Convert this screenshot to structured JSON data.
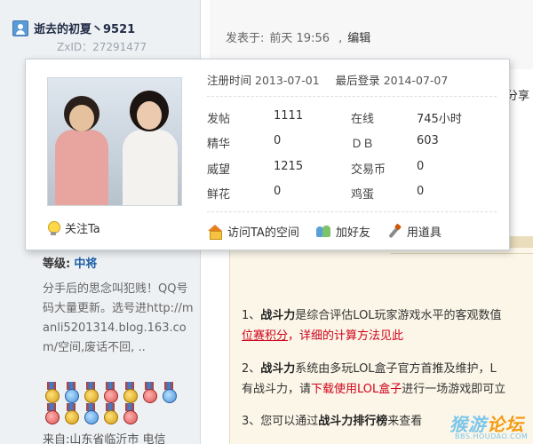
{
  "user": {
    "name": "逝去的初夏丶9521",
    "zxid": "ZxID：27291477",
    "level_label": "等级:",
    "level_value": "中将",
    "signature": "分手后的思念叫犯贱！QQ号码大量更新。选号进http://manli5201314.blog.163.com/空间,废话不回, ..",
    "from": "来自:山东省临沂市 电信",
    "medals": [
      "medal-1",
      "medal-2",
      "medal-3",
      "medal-4",
      "medal-5",
      "medal-6",
      "medal-7",
      "medal-8",
      "medal-9",
      "medal-10",
      "medal-11",
      "medal-12"
    ]
  },
  "post": {
    "meta_prefix": "发表于:",
    "meta_time": "前天 19:56",
    "meta_sep": ",",
    "edit_label": "编辑",
    "partial_share": "分享",
    "para1": {
      "num": "1、",
      "term": "战斗力",
      "text1": "是综合评估LOL玩家游戏水平的客观数值",
      "line2_link": "位赛积分",
      "line2_red": "，详细的计算方法见此"
    },
    "para2": {
      "num": "2、",
      "term": "战斗力",
      "text1": "系统由多玩LOL盒子官方首推及维护，L",
      "line2_prefix": "有战斗力，请",
      "line2_red": "下载使用LOL盒子",
      "line2_suffix": "进行一场游戏即可立"
    },
    "para3": {
      "prefix": "3、您可以通过",
      "red": "战斗力排行榜",
      "suffix": "来查看"
    }
  },
  "popup": {
    "reg_label": "注册时间",
    "reg_date": "2013-07-01",
    "login_label": "最后登录",
    "login_date": "2014-07-07",
    "stats": [
      {
        "label": "发帖",
        "value": "1111"
      },
      {
        "label": "在线",
        "value": "745小时"
      },
      {
        "label": "精华",
        "value": "0"
      },
      {
        "label": "ＤＢ",
        "value": "603"
      },
      {
        "label": "威望",
        "value": "1215"
      },
      {
        "label": "交易币",
        "value": "0"
      },
      {
        "label": "鲜花",
        "value": "0"
      },
      {
        "label": "鸡蛋",
        "value": "0"
      }
    ],
    "follow_label": "关注Ta",
    "actions": {
      "space": "访问TA的空间",
      "add_friend": "加好友",
      "use_tool": "用道具"
    }
  },
  "watermark": {
    "logo_a": "猴游",
    "logo_b": "论坛",
    "url": "BBS.HOUDAO.COM"
  }
}
